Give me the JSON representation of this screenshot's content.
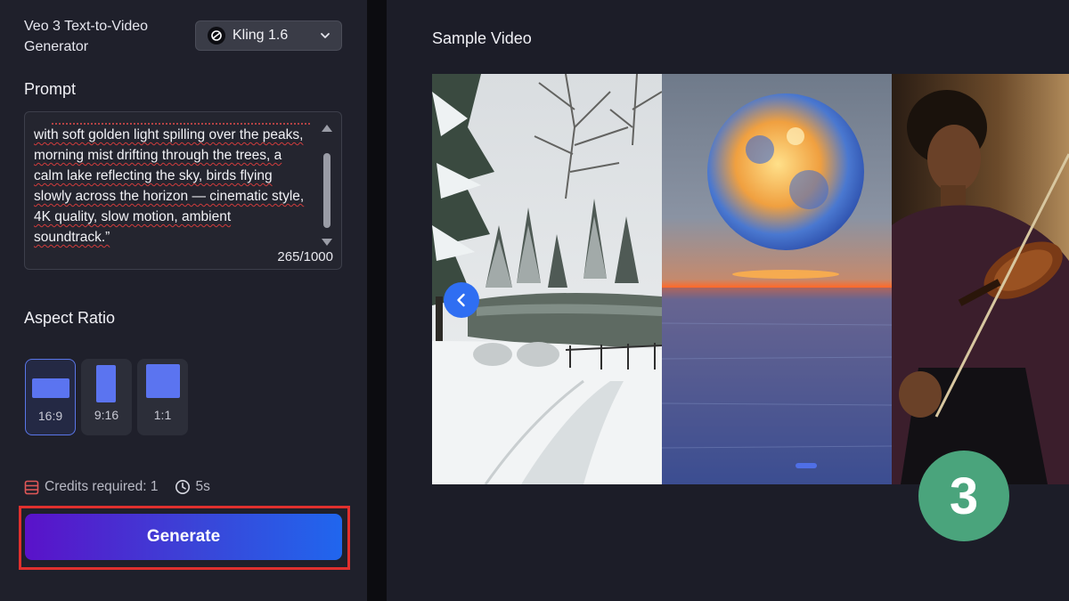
{
  "tool": {
    "title": "Veo 3 Text-to-Video Generator"
  },
  "model_select": {
    "value": "Kling 1.6"
  },
  "prompt": {
    "label": "Prompt",
    "text": "with soft golden light spilling over the peaks, morning mist drifting through the trees, a calm lake reflecting the sky, birds flying slowly across the horizon — cinematic style, 4K quality, slow motion, ambient soundtrack.”",
    "char_count": "265/1000"
  },
  "aspect_ratio": {
    "label": "Aspect Ratio",
    "options": [
      {
        "label": "16:9",
        "selected": true
      },
      {
        "label": "9:16",
        "selected": false
      },
      {
        "label": "1:1",
        "selected": false
      }
    ]
  },
  "credits": {
    "text": "Credits required: 1",
    "duration": "5s"
  },
  "generate_button": {
    "label": "Generate"
  },
  "sample": {
    "title": "Sample Video",
    "slides": [
      "snowy-landscape",
      "glowing-moon-over-sea",
      "violinist"
    ]
  },
  "step_badge": {
    "number": "3"
  },
  "colors": {
    "accent": "#5b74f0",
    "highlight": "#e0302e",
    "badge": "#4aa47c",
    "generate_gradient_start": "#5a12c9",
    "generate_gradient_end": "#2066ee"
  },
  "icons": {
    "model": "kling-logo-icon",
    "dropdown": "chevron-down-icon",
    "credits": "credits-card-icon",
    "time": "clock-icon",
    "prev": "chevron-left-icon"
  }
}
